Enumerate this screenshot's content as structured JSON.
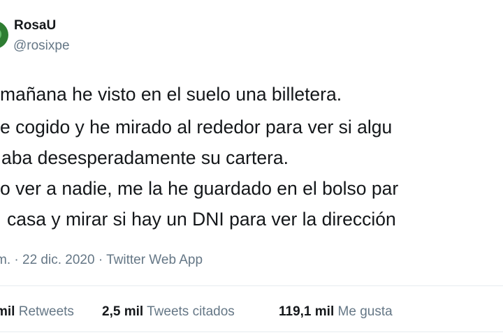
{
  "user": {
    "display_name": "RosaU",
    "handle": "@rosixpe",
    "avatar_color": "#2e7d32"
  },
  "tweet": {
    "lines": [
      "mañana he visto en el suelo una billetera.",
      "e cogido y he mirado al rededor para ver si algu",
      "aba desesperadamente su cartera.",
      "o ver a nadie, me la he guardado en el bolso par",
      "casa y mirar si hay un DNI para ver la dirección"
    ]
  },
  "meta": {
    "time": "m.",
    "separator": "·",
    "date": "22 dic. 2020",
    "source": "Twitter Web App"
  },
  "stats": {
    "retweets_count": "mil",
    "retweets_label": "Retweets",
    "quotes_count": "2,5 mil",
    "quotes_label": "Tweets citados",
    "likes_count": "119,1 mil",
    "likes_label": "Me gusta"
  },
  "colors": {
    "text": "#14171a",
    "secondary": "#657786",
    "divider": "#e6ecf0"
  }
}
